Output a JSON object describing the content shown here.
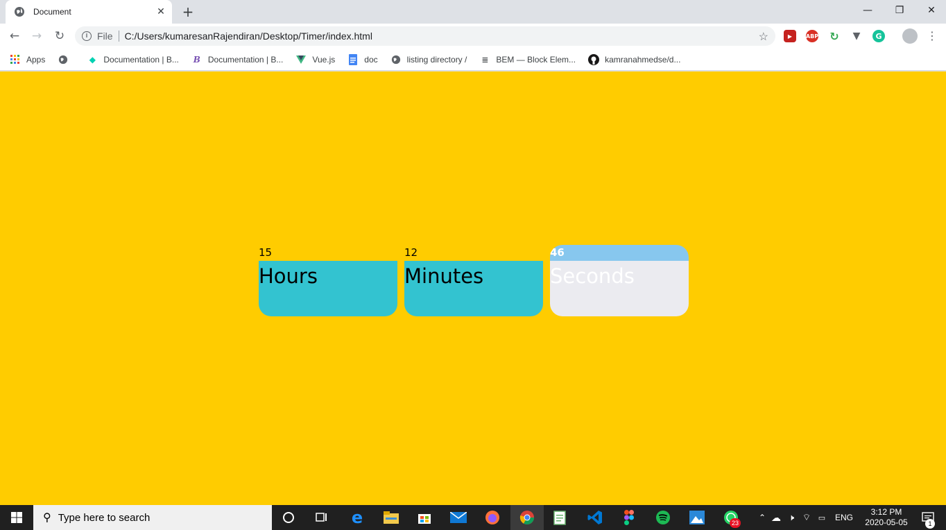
{
  "browser": {
    "tab": {
      "title": "Document"
    },
    "address": {
      "scheme": "File",
      "url": "C:/Users/kumaresanRajendiran/Desktop/Timer/index.html"
    },
    "bookmarks": [
      {
        "label": "Apps",
        "icon": "apps-grid-icon"
      },
      {
        "label": "",
        "icon": "globe-icon"
      },
      {
        "label": "Documentation | B...",
        "icon": "bootstrap-leaf-icon"
      },
      {
        "label": "Documentation | B...",
        "icon": "bulma-b-icon"
      },
      {
        "label": "Vue.js",
        "icon": "vue-icon"
      },
      {
        "label": "doc",
        "icon": "docs-icon"
      },
      {
        "label": "listing directory /",
        "icon": "globe-icon"
      },
      {
        "label": "BEM — Block Elem...",
        "icon": "document-icon"
      },
      {
        "label": "kamranahmedse/d...",
        "icon": "github-icon"
      }
    ]
  },
  "timer": {
    "hours": {
      "value": "15",
      "label": "Hours"
    },
    "minutes": {
      "value": "12",
      "label": "Minutes"
    },
    "seconds": {
      "value": "46",
      "label": "Seconds"
    }
  },
  "colors": {
    "page_background": "#ffcc00",
    "card": "#33c3d0",
    "active_header": "#87c7ee",
    "active_card": "#ebebf0"
  },
  "taskbar": {
    "search_placeholder": "Type here to search",
    "language": "ENG",
    "time": "3:12 PM",
    "date": "2020-05-05",
    "whatsapp_badge": "23",
    "notification_badge": "1"
  }
}
